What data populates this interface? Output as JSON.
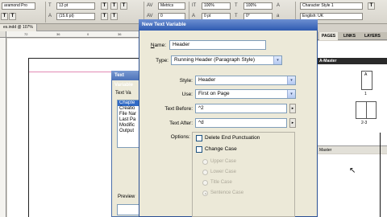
{
  "control_panel": {
    "font_family": "aramond Pro",
    "font_size": "13 pt",
    "leading": "(15.6 pt)",
    "kerning": "Metrics",
    "tracking": "0",
    "scale_v": "100%",
    "scale_h": "100%",
    "baseline_shift": "0 pt",
    "skew": "0°",
    "character_style": "Character Style 1",
    "language": "English: UK",
    "formatting_buttons": [
      "T",
      "T",
      "T",
      "T",
      "T",
      "T",
      "T",
      "T"
    ]
  },
  "document": {
    "tab_label": "es.indd @ 107%",
    "ruler_ticks": [
      "72",
      "36",
      "0",
      "36"
    ]
  },
  "back_dialog": {
    "title": "Text Variable",
    "label": "Text Va",
    "items": [
      "Chapte",
      "Creatio",
      "File Nar",
      "Last Pa",
      "Modific",
      "Output"
    ],
    "selected_index": 0,
    "preview_label": "Preview"
  },
  "main_dialog": {
    "title": "New Text Variable",
    "name_label": "Name:",
    "name_value": "Header",
    "type_label": "Type:",
    "type_value": "Running Header (Paragraph Style)",
    "style_label": "Style:",
    "style_value": "Header",
    "use_label": "Use:",
    "use_value": "First on Page",
    "text_before_label": "Text Before:",
    "text_before_value": "^2",
    "text_after_label": "Text After:",
    "text_after_value": "^d",
    "options_label": "Options:",
    "delete_end_punctuation": "Delete End Punctuation",
    "change_case": "Change Case",
    "case_options": [
      "Upper Case",
      "Lower Case",
      "Title Case",
      "Sentence Case"
    ],
    "case_selected_index": 3,
    "arrow_glyph": "▸",
    "dropdown_glyph": "▾"
  },
  "right_panel": {
    "tab_pages": "PAGES",
    "tab_links": "LINKS",
    "tab_layers": "LAYERS",
    "master_label": "A-Master",
    "page1_number": "1",
    "spread_label": "2-3",
    "footer_label": "Master",
    "page_icon": "A"
  },
  "colors": {
    "title_bar": "#2f5bb1",
    "selection": "#316ac5",
    "margin_guide": "#e28ab4"
  }
}
